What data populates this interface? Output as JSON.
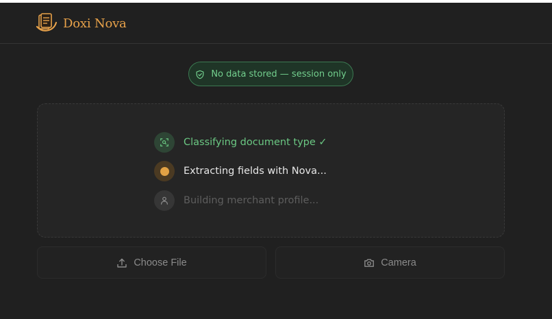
{
  "header": {
    "brand": "Doxi Nova",
    "logo_icon": "stacked-document-logo-icon",
    "brand_color": "#e8a24a"
  },
  "badge": {
    "icon": "shield-check-icon",
    "text": "No data stored — session only",
    "color": "#73cf8e"
  },
  "steps": [
    {
      "label": "Classifying document type ✓",
      "status": "done",
      "icon": "scan-search-icon"
    },
    {
      "label": "Extracting fields with Nova...",
      "status": "active",
      "icon": "progress-dot-icon"
    },
    {
      "label": "Building merchant profile...",
      "status": "pending",
      "icon": "user-icon"
    }
  ],
  "actions": {
    "choose_file": {
      "label": "Choose File",
      "icon": "upload-icon"
    },
    "camera": {
      "label": "Camera",
      "icon": "camera-icon"
    }
  },
  "colors": {
    "background": "#202020",
    "success": "#6bc883",
    "active": "#e2a245",
    "muted": "#5e5e5e"
  }
}
